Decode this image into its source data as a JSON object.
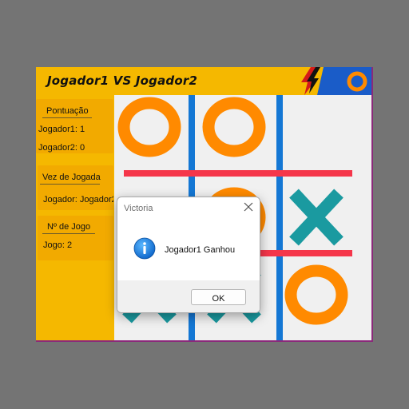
{
  "window": {
    "title": "Jogador1 VS Jogador2"
  },
  "score": {
    "heading": "Pontuação",
    "player1": "Jogador1: 1",
    "player2": "Jogador2: 0"
  },
  "turn": {
    "heading": "Vez de Jogada",
    "value": "Jogador: Jogador2"
  },
  "game": {
    "heading": "Nº de Jogo",
    "value": "Jogo: 2"
  },
  "board": {
    "cells": [
      "O",
      "O",
      "",
      "",
      "O",
      "X",
      "X",
      "X",
      "O"
    ],
    "colors": {
      "o": "#ff8a00",
      "x": "#1a9aa0",
      "vertical_lines": "#1477d4",
      "horizontal_lines": "#f5364a"
    }
  },
  "dialog": {
    "title": "Victoria",
    "message": "Jogador1 Ganhou",
    "ok_label": "OK",
    "icon": "info-icon"
  }
}
